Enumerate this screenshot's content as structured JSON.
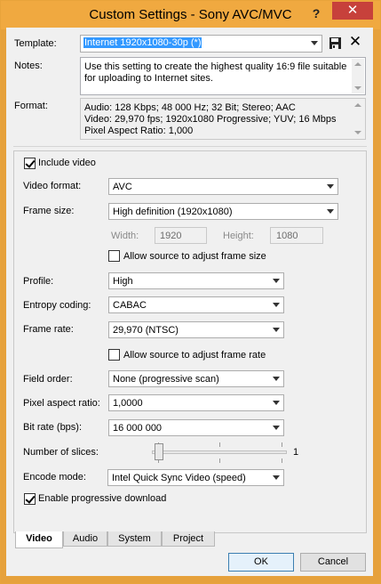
{
  "window": {
    "title": "Custom Settings - Sony AVC/MVC",
    "help_glyph": "?",
    "close_glyph": "✕"
  },
  "template": {
    "label": "Template:",
    "value": "Internet 1920x1080-30p (*)",
    "save_icon": "save-icon",
    "delete_icon": "delete-icon",
    "delete_glyph": "✕"
  },
  "notes": {
    "label": "Notes:",
    "lines": [
      "Use this setting to create the highest quality 16:9 file suitable",
      "for uploading to Internet sites."
    ]
  },
  "format": {
    "label": "Format:",
    "lines": [
      "Audio: 128 Kbps; 48 000 Hz; 32 Bit; Stereo; AAC",
      "Video: 29,970 fps; 1920x1080 Progressive; YUV; 16 Mbps",
      "Pixel Aspect Ratio: 1,000"
    ]
  },
  "video": {
    "include_video_label": "Include video",
    "include_video_checked": true,
    "video_format_label": "Video format:",
    "video_format_value": "AVC",
    "frame_size_label": "Frame size:",
    "frame_size_value": "High definition (1920x1080)",
    "width_label": "Width:",
    "width_value": "1920",
    "height_label": "Height:",
    "height_value": "1080",
    "allow_frame_size_label": "Allow source to adjust frame size",
    "allow_frame_size_checked": false,
    "profile_label": "Profile:",
    "profile_value": "High",
    "entropy_label": "Entropy coding:",
    "entropy_value": "CABAC",
    "frame_rate_label": "Frame rate:",
    "frame_rate_value": "29,970 (NTSC)",
    "allow_frame_rate_label": "Allow source to adjust frame rate",
    "allow_frame_rate_checked": false,
    "field_order_label": "Field order:",
    "field_order_value": "None (progressive scan)",
    "par_label": "Pixel aspect ratio:",
    "par_value": "1,0000",
    "bitrate_label": "Bit rate (bps):",
    "bitrate_value": "16 000 000",
    "slices_label": "Number of slices:",
    "slices_value": "1",
    "encode_mode_label": "Encode mode:",
    "encode_mode_value": "Intel Quick Sync Video (speed)",
    "progressive_download_label": "Enable progressive download",
    "progressive_download_checked": true
  },
  "tabs": [
    {
      "label": "Video",
      "active": true
    },
    {
      "label": "Audio",
      "active": false
    },
    {
      "label": "System",
      "active": false
    },
    {
      "label": "Project",
      "active": false
    }
  ],
  "buttons": {
    "ok": "OK",
    "cancel": "Cancel"
  },
  "colors": {
    "title_bar": "#f0a940",
    "close_button": "#c7413b",
    "selection": "#3399ff"
  }
}
